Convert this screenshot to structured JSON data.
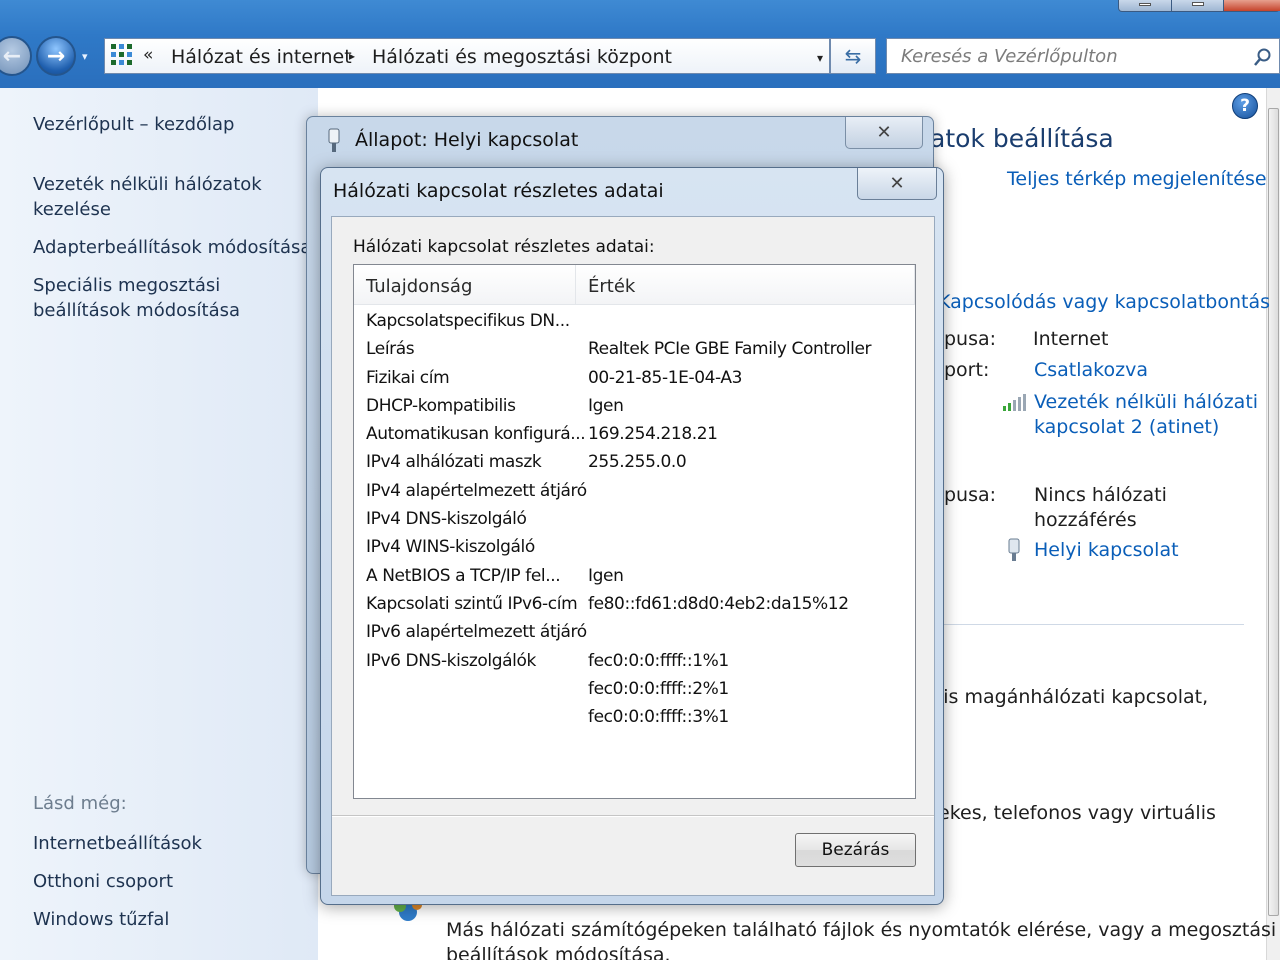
{
  "explorer": {
    "back_glyph": "←",
    "forward_glyph": "→",
    "recent_dropdown_glyph": "▾",
    "breadcrumb": {
      "overflow_glyph": "«",
      "separator_glyph": "▸",
      "items": [
        "Hálózat és internet",
        "Hálózati és megosztási központ"
      ]
    },
    "address_dropdown_glyph": "▾",
    "refresh_glyph": "⇆",
    "search_placeholder": "Keresés a Vezérlőpulton"
  },
  "left_pane": {
    "home_link": "Vezérlőpult – kezdőlap",
    "links": [
      [
        "Vezeték nélküli hálózatok",
        "kezelése"
      ],
      [
        "Adapterbeállítások módosítása"
      ],
      [
        "Speciális megosztási",
        "beállítások módosítása"
      ]
    ],
    "see_also_label": "Lásd még:",
    "see_also": [
      "Internetbeállítások",
      "Otthoni csoport",
      "Windows tűzfal"
    ]
  },
  "main": {
    "help_glyph": "?",
    "heading_fragment": "atok beállítása",
    "full_map_link": "Teljes térkép megjelenítése",
    "connect_link": "Kapcsolódás vagy kapcsolatbontás",
    "network1": {
      "access_type_label_fragment": "pusa:",
      "access_type_value": "Internet",
      "homegroup_label_fragment": "port:",
      "homegroup_value": "Csatlakozva",
      "connection_lines": [
        "Vezeték nélküli hálózati",
        "kapcsolat 2 (atinet)"
      ]
    },
    "network2": {
      "access_type_label_fragment": "pusa:",
      "access_type_lines": [
        "Nincs hálózati",
        "hozzáférés"
      ],
      "connection": "Helyi kapcsolat"
    },
    "task_fragment_1": "lis magánhálózati kapcsolat,",
    "task_fragment_2": "ekes, telefonos vagy virtuális",
    "bottom_task_lines": [
      "Más hálózati számítógépeken található fájlok és nyomtatók elérése, vagy a megosztási",
      "beállítások módosítása."
    ]
  },
  "status_dialog": {
    "title": "Állapot: Helyi kapcsolat",
    "close_glyph": "✕"
  },
  "details_dialog": {
    "title": "Hálózati kapcsolat részletes adatai",
    "close_glyph": "✕",
    "label": "Hálózati kapcsolat részletes adatai:",
    "columns": [
      "Tulajdonság",
      "Érték"
    ],
    "rows": [
      [
        "Kapcsolatspecifikus DN...",
        ""
      ],
      [
        "Leírás",
        "Realtek PCIe GBE Family Controller"
      ],
      [
        "Fizikai cím",
        "00-21-85-1E-04-A3"
      ],
      [
        "DHCP-kompatibilis",
        "Igen"
      ],
      [
        "Automatikusan konfigurá...",
        "169.254.218.21"
      ],
      [
        "IPv4 alhálózati maszk",
        "255.255.0.0"
      ],
      [
        "IPv4 alapértelmezett átjáró",
        ""
      ],
      [
        "IPv4 DNS-kiszolgáló",
        ""
      ],
      [
        "IPv4 WINS-kiszolgáló",
        ""
      ],
      [
        "A NetBIOS a TCP/IP fel...",
        "Igen"
      ],
      [
        "Kapcsolati szintű IPv6-cím",
        "fe80::fd61:d8d0:4eb2:da15%12"
      ],
      [
        "IPv6 alapértelmezett átjáró",
        ""
      ],
      [
        "IPv6 DNS-kiszolgálók",
        "fec0:0:0:ffff::1%1"
      ],
      [
        "",
        "fec0:0:0:ffff::2%1"
      ],
      [
        "",
        "fec0:0:0:ffff::3%1"
      ]
    ],
    "close_button": "Bezárás"
  },
  "colors": {
    "titlebar": "#2f79c7",
    "link": "#0a5eb8",
    "nav_text": "#1e3350",
    "pane_bg": "#e6eef8"
  }
}
